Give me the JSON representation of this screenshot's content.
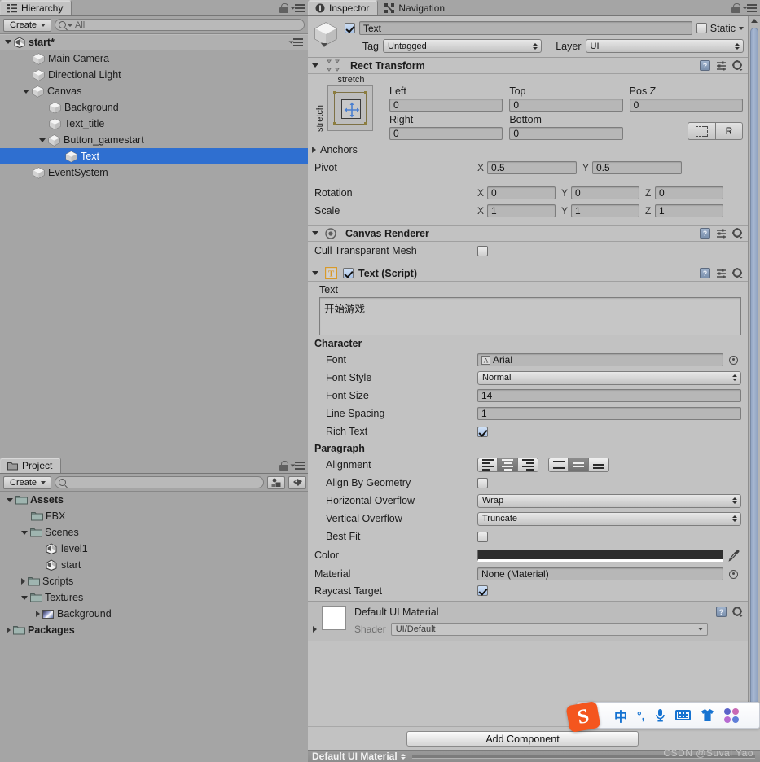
{
  "hierarchy": {
    "tab_label": "Hierarchy",
    "create_label": "Create",
    "search_placeholder": "All",
    "scene_name": "start*",
    "items": [
      {
        "label": "Main Camera",
        "depth": 1,
        "arrow": "none",
        "icon": "cube-icon",
        "selected": false
      },
      {
        "label": "Directional Light",
        "depth": 1,
        "arrow": "none",
        "icon": "cube-icon",
        "selected": false
      },
      {
        "label": "Canvas",
        "depth": 1,
        "arrow": "open",
        "icon": "cube-icon",
        "selected": false
      },
      {
        "label": "Background",
        "depth": 2,
        "arrow": "none",
        "icon": "cube-icon",
        "selected": false
      },
      {
        "label": "Text_title",
        "depth": 2,
        "arrow": "none",
        "icon": "cube-icon",
        "selected": false
      },
      {
        "label": "Button_gamestart",
        "depth": 2,
        "arrow": "open",
        "icon": "cube-icon",
        "selected": false
      },
      {
        "label": "Text",
        "depth": 3,
        "arrow": "none",
        "icon": "cube-icon",
        "selected": true
      },
      {
        "label": "EventSystem",
        "depth": 1,
        "arrow": "none",
        "icon": "cube-icon",
        "selected": false
      }
    ]
  },
  "project": {
    "tab_label": "Project",
    "create_label": "Create",
    "search_placeholder": "",
    "items": [
      {
        "label": "Assets",
        "depth": 0,
        "arrow": "open",
        "icon": "folder-icon",
        "bold": true
      },
      {
        "label": "FBX",
        "depth": 1,
        "arrow": "none",
        "icon": "folder-icon",
        "bold": false
      },
      {
        "label": "Scenes",
        "depth": 1,
        "arrow": "open",
        "icon": "folder-icon",
        "bold": false
      },
      {
        "label": "level1",
        "depth": 2,
        "arrow": "none",
        "icon": "unity-scene-icon",
        "bold": false
      },
      {
        "label": "start",
        "depth": 2,
        "arrow": "none",
        "icon": "unity-scene-icon",
        "bold": false
      },
      {
        "label": "Scripts",
        "depth": 1,
        "arrow": "closed",
        "icon": "folder-icon",
        "bold": false
      },
      {
        "label": "Textures",
        "depth": 1,
        "arrow": "open",
        "icon": "folder-icon",
        "bold": false
      },
      {
        "label": "Background",
        "depth": 2,
        "arrow": "closed",
        "icon": "texture-icon",
        "bold": false
      },
      {
        "label": "Packages",
        "depth": 0,
        "arrow": "closed",
        "icon": "folder-icon",
        "bold": true
      }
    ]
  },
  "inspector": {
    "tabs": [
      {
        "label": "Inspector",
        "active": true
      },
      {
        "label": "Navigation",
        "active": false
      }
    ],
    "object": {
      "enabled": true,
      "name": "Text",
      "static_label": "Static",
      "static_checked": false,
      "tag_label": "Tag",
      "tag_value": "Untagged",
      "layer_label": "Layer",
      "layer_value": "UI"
    },
    "rect_transform": {
      "title": "Rect Transform",
      "anchor_preset_top": "stretch",
      "anchor_preset_left": "stretch",
      "left_label": "Left",
      "left_value": "0",
      "top_label": "Top",
      "top_value": "0",
      "posz_label": "Pos Z",
      "posz_value": "0",
      "right_label": "Right",
      "right_value": "0",
      "bottom_label": "Bottom",
      "bottom_value": "0",
      "blueprint_label": "",
      "raw_label": "R",
      "anchors_label": "Anchors",
      "pivot_label": "Pivot",
      "pivot_x": "0.5",
      "pivot_y": "0.5",
      "rotation_label": "Rotation",
      "rotation_x": "0",
      "rotation_y": "0",
      "rotation_z": "0",
      "scale_label": "Scale",
      "scale_x": "1",
      "scale_y": "1",
      "scale_z": "1",
      "axis_x": "X",
      "axis_y": "Y",
      "axis_z": "Z"
    },
    "canvas_renderer": {
      "title": "Canvas Renderer",
      "cull_label": "Cull Transparent Mesh",
      "cull_checked": false
    },
    "text_script": {
      "title": "Text (Script)",
      "enabled": true,
      "text_label": "Text",
      "text_value": "开始游戏",
      "character_header": "Character",
      "font_label": "Font",
      "font_value": "Arial",
      "font_style_label": "Font Style",
      "font_style_value": "Normal",
      "font_size_label": "Font Size",
      "font_size_value": "14",
      "line_spacing_label": "Line Spacing",
      "line_spacing_value": "1",
      "rich_text_label": "Rich Text",
      "rich_text_checked": true,
      "paragraph_header": "Paragraph",
      "alignment_label": "Alignment",
      "alignment_horizontal": "center",
      "alignment_vertical": "middle",
      "align_by_geometry_label": "Align By Geometry",
      "align_by_geometry_checked": false,
      "horizontal_overflow_label": "Horizontal Overflow",
      "horizontal_overflow_value": "Wrap",
      "vertical_overflow_label": "Vertical Overflow",
      "vertical_overflow_value": "Truncate",
      "best_fit_label": "Best Fit",
      "best_fit_checked": false,
      "color_label": "Color",
      "color_value": "#2e2e2e",
      "material_label": "Material",
      "material_value": "None (Material)",
      "raycast_target_label": "Raycast Target",
      "raycast_target_checked": true
    },
    "material_block": {
      "title": "Default UI Material",
      "shader_label": "Shader",
      "shader_value": "UI/Default"
    },
    "add_component_label": "Add Component",
    "status_name": "Default UI Material"
  },
  "ime": {
    "logo_label": "S",
    "mode_label": "中",
    "punct_label": "°,",
    "mic_label": "mic-icon",
    "keyboard_label": "keyboard-icon",
    "skin_label": "skin-icon",
    "more_label": "more-icon"
  },
  "watermark": "CSDN @Suval Yao",
  "colors": {
    "selection_blue": "#2f6fd0",
    "panel_bg": "#a5a5a5",
    "inspector_bg": "#c2c2c2",
    "ime_orange": "#f4561e",
    "ime_blue": "#1673d1"
  }
}
